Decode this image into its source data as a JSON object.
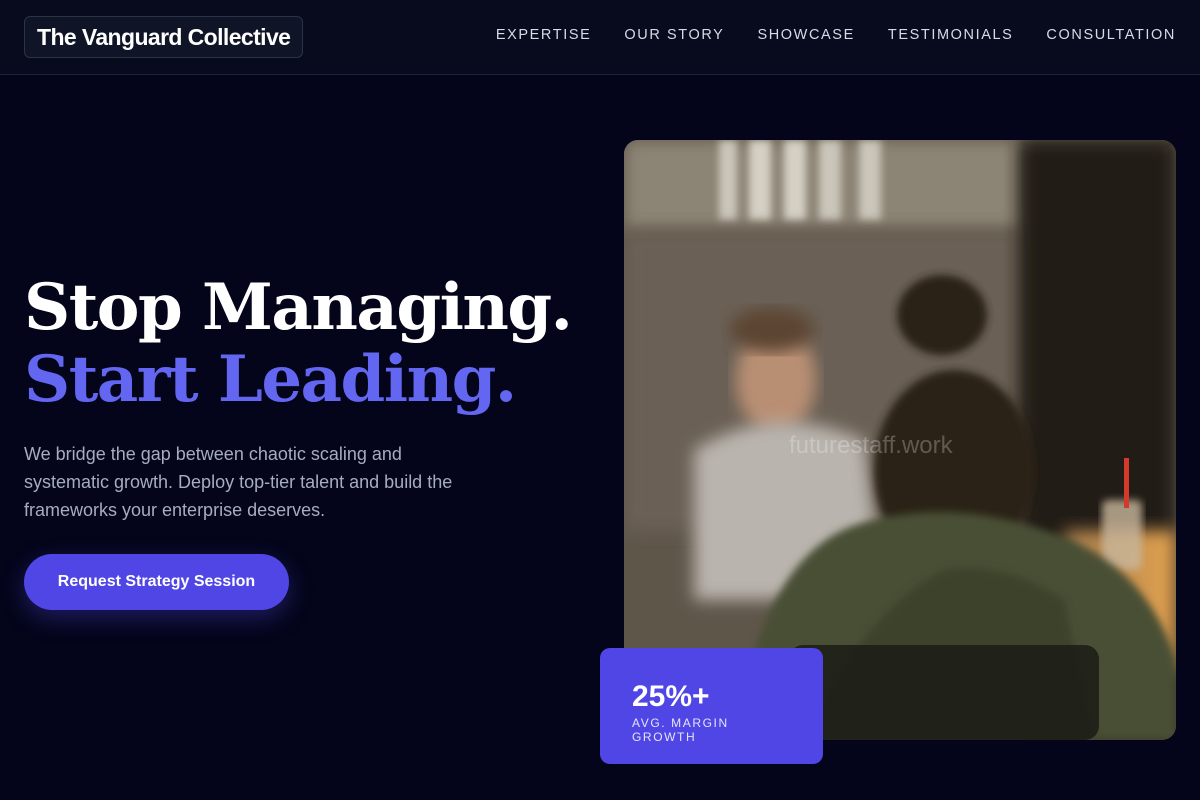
{
  "header": {
    "logo_text": "The Vanguard Collective",
    "nav": [
      "EXPERTISE",
      "OUR STORY",
      "SHOWCASE",
      "TESTIMONIALS",
      "CONSULTATION"
    ]
  },
  "hero": {
    "title_line1": "Stop Managing.",
    "title_line2": "Start Leading.",
    "description": "We bridge the gap between chaotic scaling and systematic growth. Deploy top-tier talent and build the frameworks your enterprise deserves.",
    "cta_label": "Request Strategy Session"
  },
  "image": {
    "watermark": "futurestaff.work"
  },
  "stat": {
    "value": "25%+",
    "label": "AVG. MARGIN GROWTH"
  },
  "colors": {
    "background": "#04051a",
    "accent": "#6366f1",
    "button": "#4f46e5"
  }
}
